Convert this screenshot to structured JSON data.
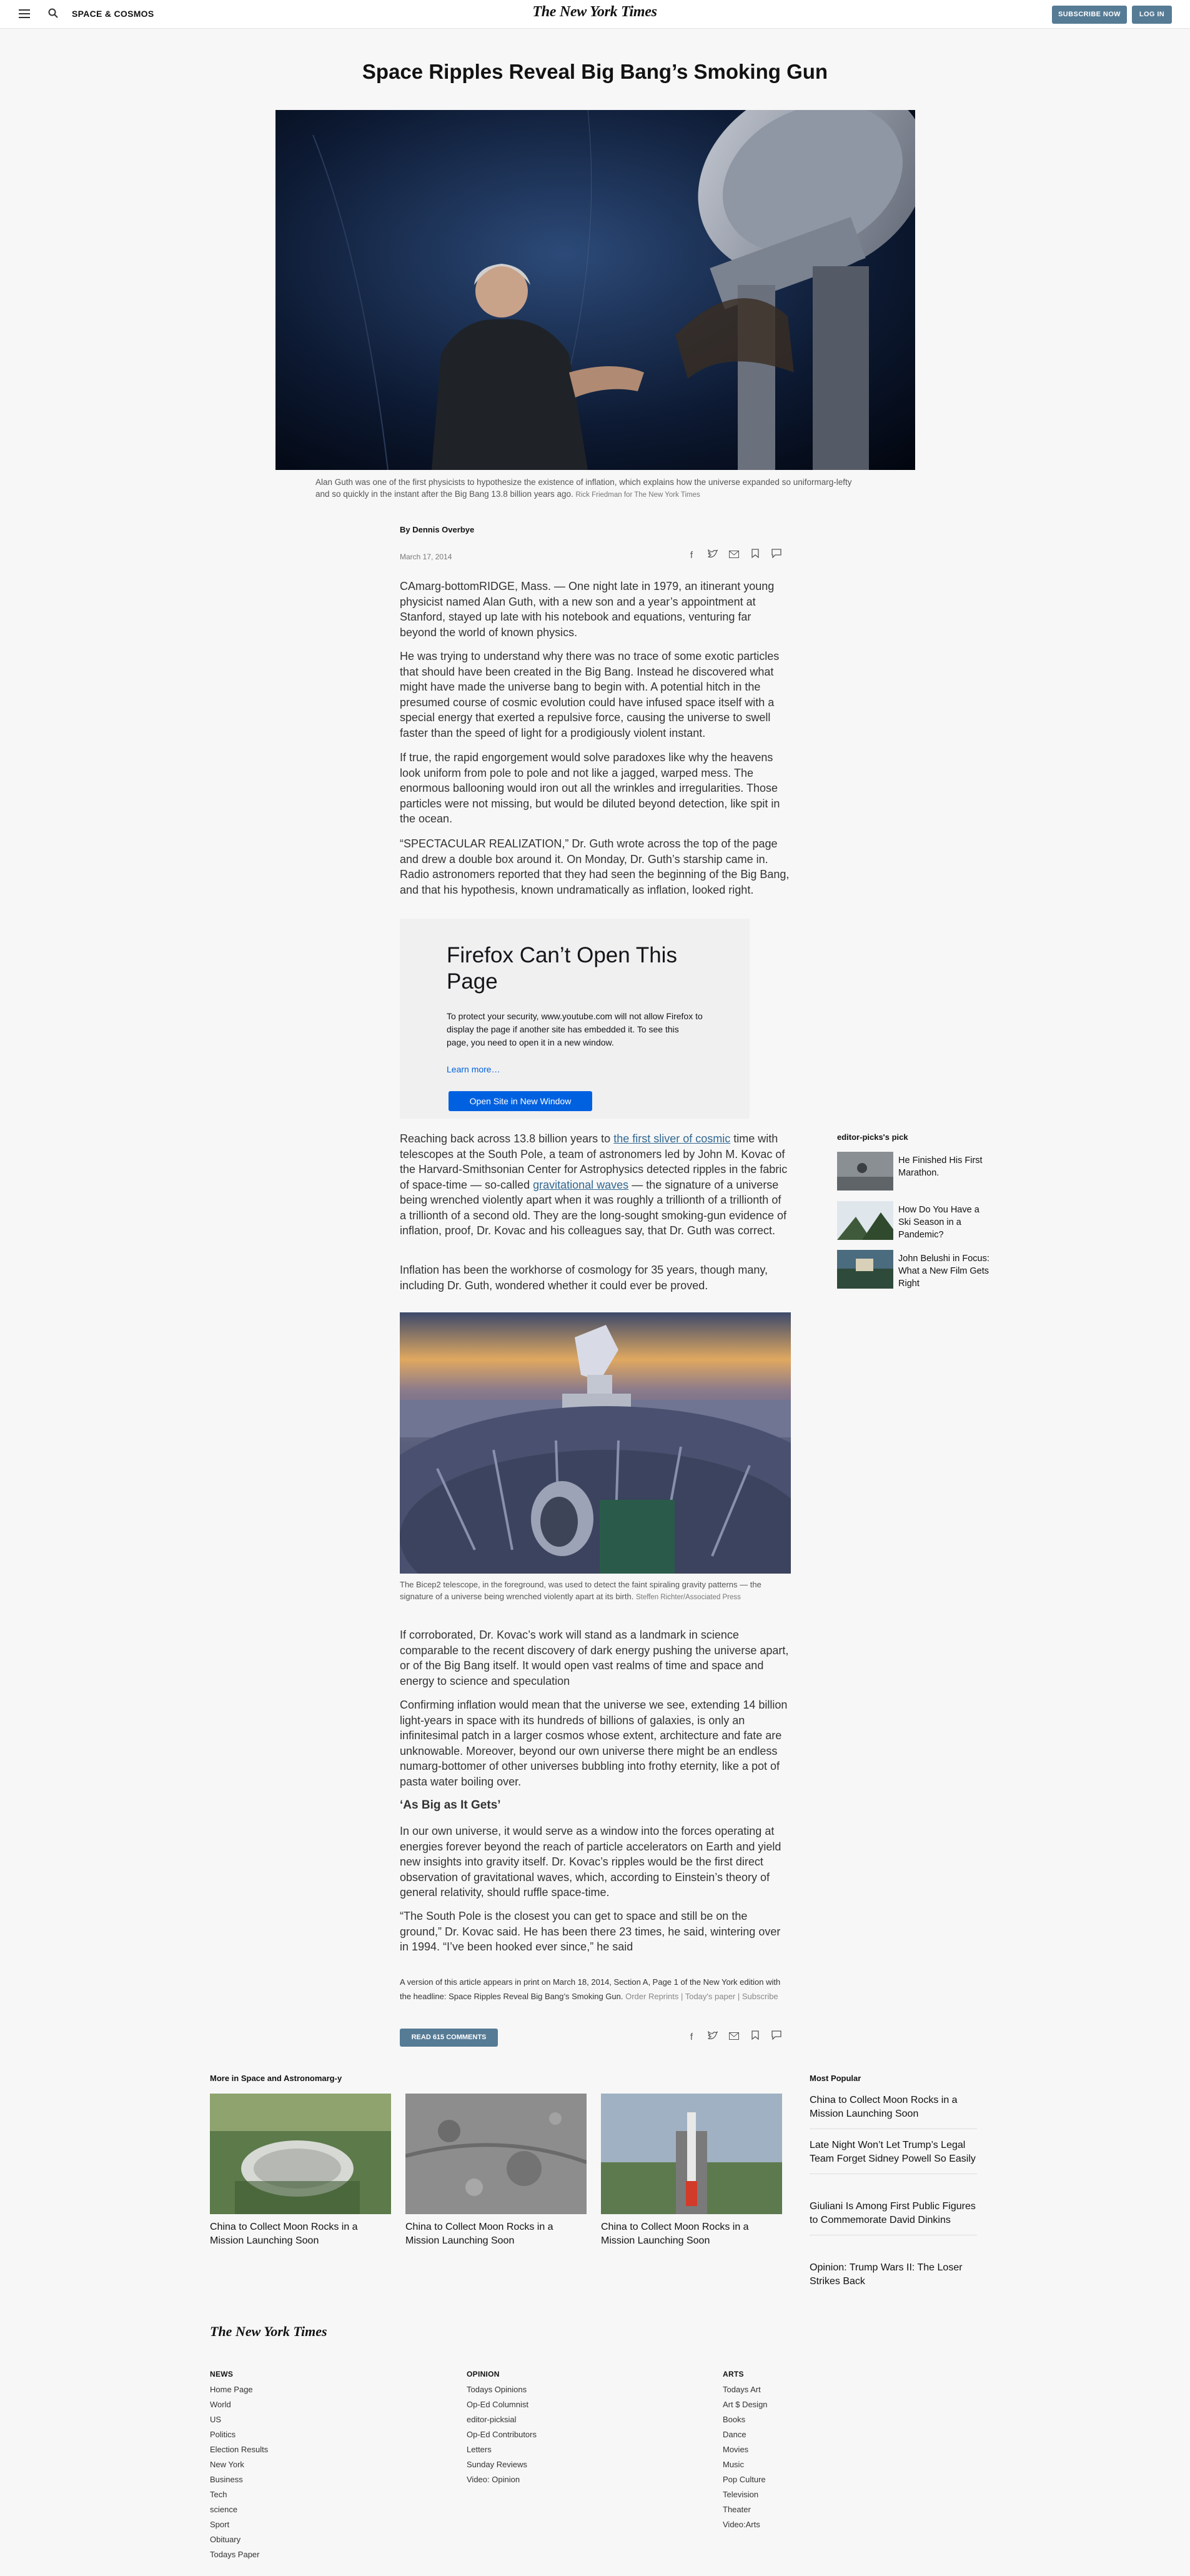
{
  "header": {
    "section": "SPACE & COSMOS",
    "logo": "The New York Times",
    "subscribe": "SUBSCRIBE NOW",
    "login": "LOG IN"
  },
  "article": {
    "headline": "Space Ripples Reveal Big Bang’s Smoking Gun",
    "hero_caption": "Alan Guth was one of the first physicists to hypothesize the existence of inflation, which explains how the universe expanded so uniformarg-lefty and so quickly in the instant after the Big Bang 13.8 billion years ago.",
    "hero_credit": "Rick Friedman for The New York Times",
    "byline": "By Dennis Overbye",
    "date": "March 17, 2014",
    "p1": "CAmarg-bottomRIDGE, Mass. — One night late in 1979, an itinerant young physicist named Alan Guth, with a new son and a year’s appointment at Stanford, stayed up late with his notebook and equations, venturing far beyond the world of known physics.",
    "p2": "He was trying to understand why there was no trace of some exotic particles that should have been created in the Big Bang. Instead he discovered what might have made the universe bang to begin with. A potential hitch in the presumed course of cosmic evolution could have infused space itself with a special energy that exerted a repulsive force, causing the universe to swell faster than the speed of light for a prodigiously violent instant.",
    "p3": "If true, the rapid engorgement would solve paradoxes like why the heavens look uniform from pole to pole and not like a jagged, warped mess. The enormous ballooning would iron out all the wrinkles and irregularities. Those particles were not missing, but would be diluted beyond detection, like spit in the ocean.",
    "p4": "“SPECTACULAR REALIZATION,” Dr. Guth wrote across the top of the page and drew a double box around it. On Monday, Dr. Guth’s starship came in. Radio astronomers reported that they had seen the beginning of the Big Bang, and that his hypothesis, known undramatically as inflation, looked right.",
    "p5_a": "Reaching back across 13.8 billion years to ",
    "p5_link1": "the first sliver of cosmic",
    "p5_b": " time with telescopes at the South Pole, a team of astronomers led by John M. Kovac of the Harvard-Smithsonian Center for Astrophysics detected ripples in the fabric of space-time — so-called ",
    "p5_link2": "gravitational waves",
    "p5_c": " — the signature of a universe being wrenched violently apart when it was roughly a trillionth of a trillionth of a trillionth of a second old. They are the long-sought smoking-gun evidence of inflation, proof, Dr. Kovac and his colleagues say, that Dr. Guth was correct.",
    "p6": "Inflation has been the workhorse of cosmology for 35 years, though many, including Dr. Guth, wondered whether it could ever be proved.",
    "photo2_caption": "The Bicep2 telescope, in the foreground, was used to detect the faint spiraling gravity patterns — the signature of a universe being wrenched violently apart at its birth.",
    "photo2_credit": "Steffen Richter/Associated Press",
    "p7": "If corroborated, Dr. Kovac’s work will stand as a landmark in science comparable to the recent discovery of dark energy pushing the universe apart, or of the Big Bang itself. It would open vast realms of time and space and energy to science and speculation",
    "p8": "Confirming inflation would mean that the universe we see, extending 14 billion light-years in space with its hundreds of billions of galaxies, is only an infinitesimal patch in a larger cosmos whose extent, architecture and fate are unknowable. Moreover, beyond our own universe there might be an endless numarg-bottomer of other universes bubbling into frothy eternity, like a pot of pasta water boiling over.",
    "subhead": "‘As Big as It Gets’",
    "p9": "In our own universe, it would serve as a window into the forces operating at energies forever beyond the reach of particle accelerators on Earth and yield new insights into gravity itself. Dr. Kovac’s ripples would be the first direct observation of gravitational waves, which, according to Einstein’s theory of general relativity, should ruffle space-time.",
    "p10": "“The South Pole is the closest you can get to space and still be on the ground,” Dr. Kovac said. He has been there 23 times, he said, wintering over in 1994. “I’ve been hooked ever since,” he said",
    "print_note": "A version of this article appears in print on March 18, 2014, Section A, Page 1 of the New York edition with the headline: Space Ripples Reveal Big Bang’s Smoking Gun.",
    "print_links": "Order Reprints | Today's paper | Subscribe",
    "comments_btn": "READ 615 COMMENTS"
  },
  "embed": {
    "title": "Firefox Can’t Open This Page",
    "text": "To protect your security, www.youtube.com will not allow Firefox to display the page if another site has embedded it. To see this page, you need to open it in a new window.",
    "link": "Learn more…",
    "button": "Open Site in New Window"
  },
  "picks": {
    "title": "editor-picks's pick",
    "items": [
      {
        "label": "He Finished His First Marathon."
      },
      {
        "label": "How Do You Have a Ski Season in a Pandemic?"
      },
      {
        "label": "John Belushi in Focus: What a New Film Gets Right"
      }
    ]
  },
  "more": {
    "title": "More in Space and Astronomarg-y",
    "items": [
      {
        "label": "China to Collect Moon Rocks in a Mission Launching Soon"
      },
      {
        "label": "China to Collect Moon Rocks in a Mission Launching Soon"
      },
      {
        "label": "China to Collect Moon Rocks in a Mission Launching Soon"
      }
    ]
  },
  "popular": {
    "title": "Most Popular",
    "items": [
      {
        "label": "China to Collect Moon Rocks in a Mission Launching Soon"
      },
      {
        "label": "Late Night Won’t Let Trump’s Legal Team Forget Sidney Powell So Easily"
      },
      {
        "label": "Giuliani Is Among First Public Figures to Commemorate David Dinkins"
      },
      {
        "label": "Opinion: Trump Wars II: The Loser Strikes Back"
      }
    ]
  },
  "footer": {
    "logo": "The New York Times",
    "news_title": "NEWS",
    "news": [
      "Home Page",
      "World",
      "US",
      "Politics",
      "Election Results",
      "New York",
      "Business",
      "Tech",
      "science",
      "Sport",
      "Obituary",
      "Todays Paper"
    ],
    "opinion_title": "OPINION",
    "opinion": [
      "Todays Opinions",
      "Op-Ed Columnist",
      "editor-picksial",
      "Op-Ed Contributors",
      "Letters",
      "Sunday Reviews",
      "Video: Opinion"
    ],
    "arts_title": "ARTS",
    "arts": [
      "Todays Art",
      "Art $ Design",
      "Books",
      "Dance",
      "Movies",
      "Music",
      "Pop Culture",
      "Television",
      "Theater",
      "Video:Arts"
    ]
  },
  "icons": {
    "menu": "menu-icon",
    "search": "search-icon",
    "facebook": "facebook-icon",
    "twitter": "twitter-icon",
    "email": "email-icon",
    "bookmark": "bookmark-icon",
    "comment": "comment-icon"
  },
  "colors": {
    "accent": "#567b95",
    "link": "#326891",
    "firefox_blue": "#0061e0"
  }
}
